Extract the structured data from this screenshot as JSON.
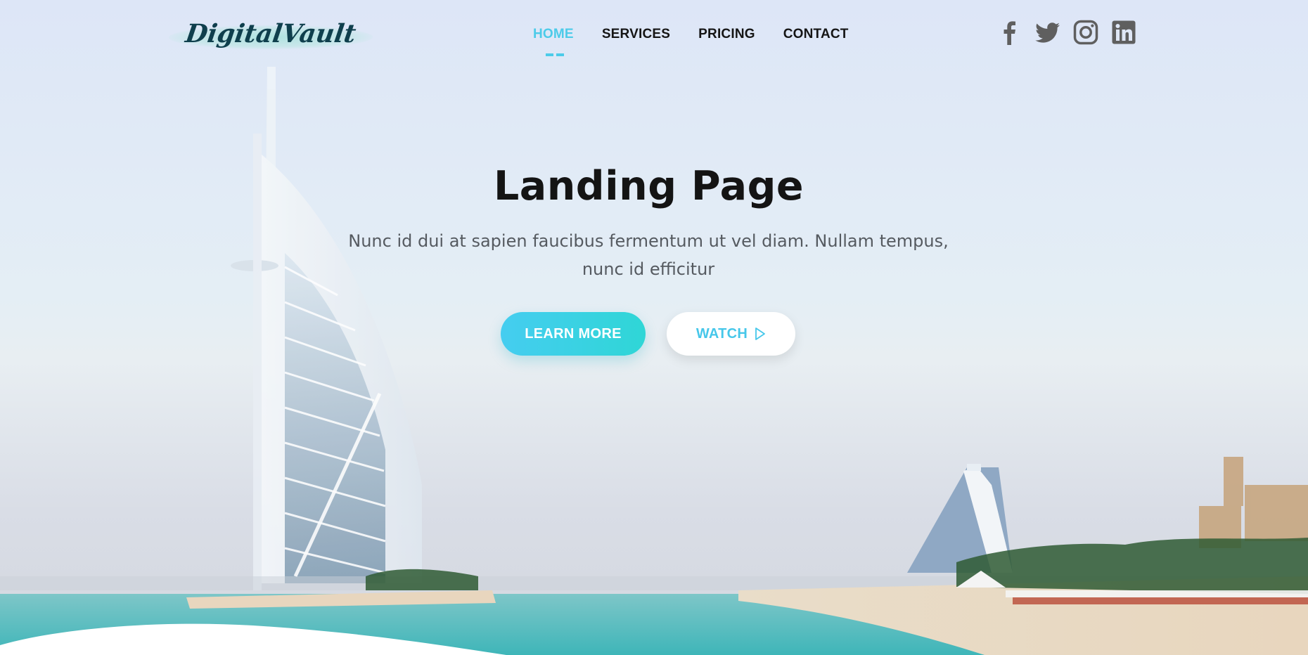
{
  "brand": {
    "logo_text": "DigitalVault"
  },
  "nav": {
    "items": [
      {
        "label": "HOME",
        "active": true
      },
      {
        "label": "SERVICES",
        "active": false
      },
      {
        "label": "PRICING",
        "active": false
      },
      {
        "label": "CONTACT",
        "active": false
      }
    ]
  },
  "social": [
    "facebook-icon",
    "twitter-icon",
    "instagram-icon",
    "linkedin-icon"
  ],
  "hero": {
    "title": "Landing Page",
    "subtitle": "Nunc id dui at sapien faucibus fermentum ut vel diam. Nullam tempus, nunc id efficitur",
    "learn_more_label": "LEARN MORE",
    "watch_label": "WATCH"
  },
  "colors": {
    "accent": "#4ccbe9",
    "button_gradient_start": "#45cdf0",
    "button_gradient_end": "#2fd6d6",
    "title": "#141414",
    "subtitle": "#555a60",
    "logo": "#0f3f4d"
  }
}
